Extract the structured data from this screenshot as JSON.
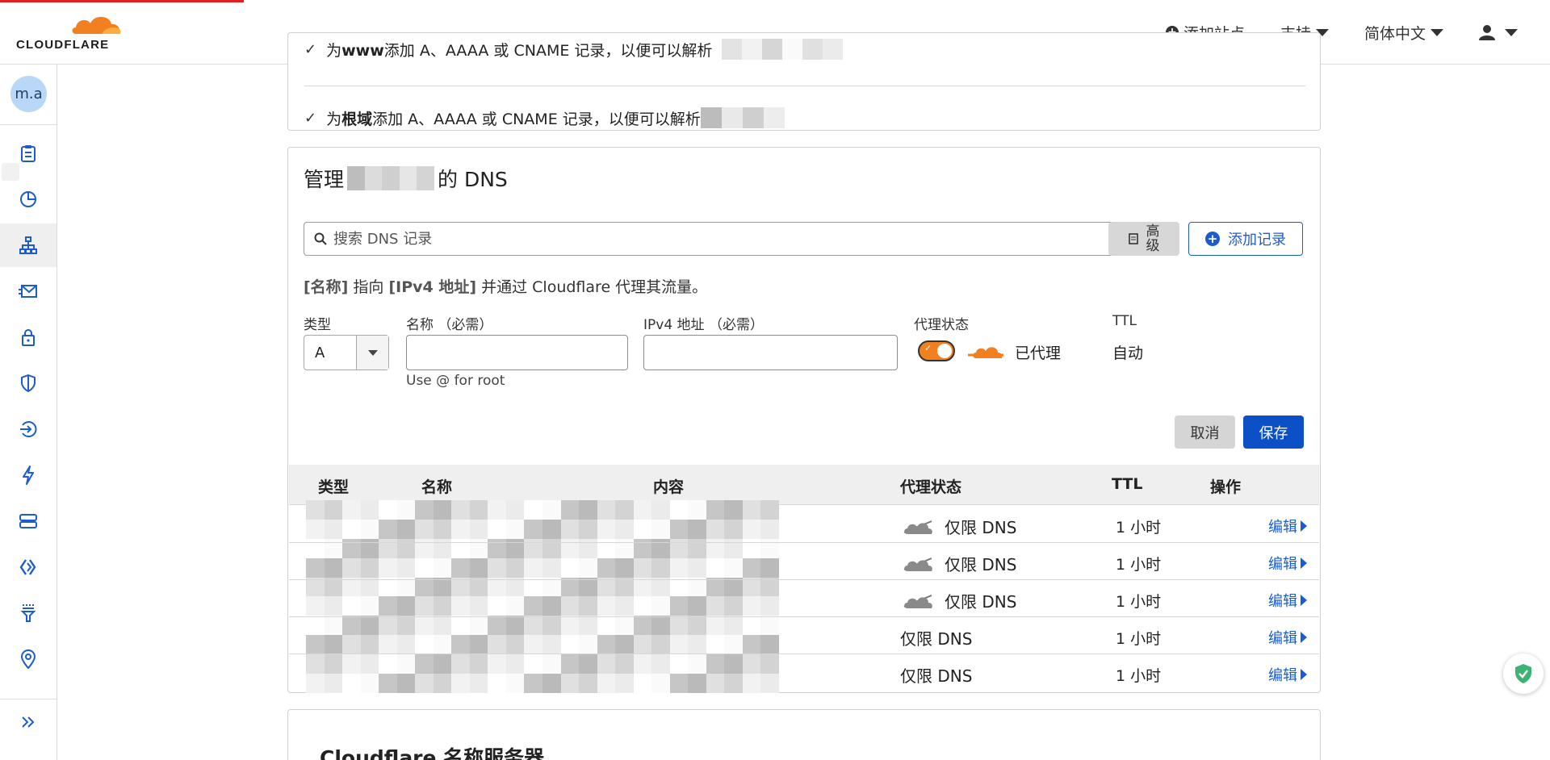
{
  "header": {
    "logo_text": "CLOUDFLARE",
    "add_site_label": "添加站点",
    "support_label": "支持",
    "language_label": "简体中文"
  },
  "sidebar": {
    "avatar_text": "m.a",
    "items": [
      {
        "icon": "clipboard-icon"
      },
      {
        "icon": "pie-chart-icon"
      },
      {
        "icon": "network-icon"
      },
      {
        "icon": "email-icon"
      },
      {
        "icon": "lock-icon"
      },
      {
        "icon": "shield-icon"
      },
      {
        "icon": "route-icon"
      },
      {
        "icon": "lightning-icon"
      },
      {
        "icon": "storage-icon"
      },
      {
        "icon": "workers-icon"
      },
      {
        "icon": "filter-icon"
      },
      {
        "icon": "location-pin-icon"
      }
    ],
    "active_index": 2
  },
  "records_hint_card": {
    "row1_prefix": "为",
    "row1_bold": "www",
    "row1_text": "添加 A、AAAA 或 CNAME 记录，以便可以解析",
    "row2_prefix": "为",
    "row2_bold": "根域",
    "row2_text": "添加 A、AAAA 或 CNAME 记录，以便可以解析"
  },
  "dns": {
    "title_prefix": "管理",
    "title_suffix": "的 DNS",
    "search_placeholder": "搜索 DNS 记录",
    "advanced_label_1": "高",
    "advanced_label_2": "级",
    "add_record_label": "添加记录",
    "hint_name": "[名称]",
    "hint_middle": "指向",
    "hint_ipv4": "[IPv4 地址]",
    "hint_tail": "并通过 Cloudflare 代理其流量。",
    "form": {
      "type_label": "类型",
      "type_value": "A",
      "name_label": "名称 （必需）",
      "name_value": "",
      "name_hint": "Use @ for root",
      "ipv4_label": "IPv4 地址 （必需）",
      "ipv4_value": "",
      "proxy_label": "代理状态",
      "proxy_on": true,
      "proxy_value": "已代理",
      "ttl_label": "TTL",
      "ttl_value": "自动"
    },
    "cancel_label": "取消",
    "save_label": "保存",
    "table": {
      "headers": {
        "type": "类型",
        "name": "名称",
        "content": "内容",
        "proxy": "代理状态",
        "ttl": "TTL",
        "actions": "操作"
      },
      "rows": [
        {
          "proxy": "仅限 DNS",
          "ttl": "1 小时",
          "edit": "编辑",
          "cloud_icon": true
        },
        {
          "proxy": "仅限 DNS",
          "ttl": "1 小时",
          "edit": "编辑",
          "cloud_icon": true
        },
        {
          "proxy": "仅限 DNS",
          "ttl": "1 小时",
          "edit": "编辑",
          "cloud_icon": true
        },
        {
          "proxy": "仅限 DNS",
          "ttl": "1 小时",
          "edit": "编辑",
          "cloud_icon": false
        },
        {
          "proxy": "仅限 DNS",
          "ttl": "1 小时",
          "edit": "编辑",
          "cloud_icon": false
        }
      ]
    }
  },
  "nameservers": {
    "title": "Cloudflare 名称服务器"
  },
  "colors": {
    "accent_blue": "#1d5ccf",
    "save_blue": "#0b50c6",
    "brand_orange": "#f38020",
    "load_bar_red": "#e02020"
  }
}
